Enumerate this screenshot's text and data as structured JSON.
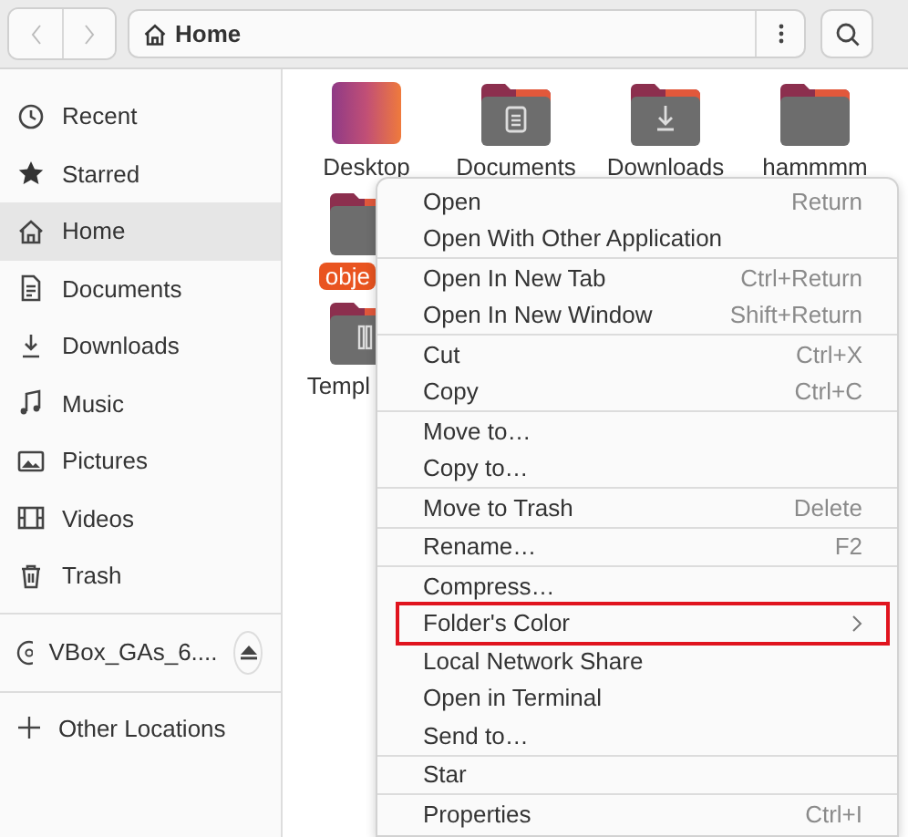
{
  "header": {
    "location": "Home"
  },
  "sidebar": {
    "items": [
      {
        "label": "Recent",
        "selected": false
      },
      {
        "label": "Starred",
        "selected": false
      },
      {
        "label": "Home",
        "selected": true
      },
      {
        "label": "Documents",
        "selected": false
      },
      {
        "label": "Downloads",
        "selected": false
      },
      {
        "label": "Music",
        "selected": false
      },
      {
        "label": "Pictures",
        "selected": false
      },
      {
        "label": "Videos",
        "selected": false
      },
      {
        "label": "Trash",
        "selected": false
      }
    ],
    "devices": [
      {
        "label": "VBox_GAs_6...."
      }
    ],
    "other": [
      {
        "label": "Other Locations"
      }
    ]
  },
  "files": [
    {
      "name": "Desktop",
      "kind": "gradient",
      "selected": false
    },
    {
      "name": "Documents",
      "kind": "folder",
      "selected": false
    },
    {
      "name": "Downloads",
      "kind": "folder",
      "selected": false
    },
    {
      "name": "hammmm",
      "kind": "folder",
      "selected": false
    },
    {
      "name": "obje",
      "kind": "folder",
      "selected": true
    },
    {
      "name": "Templ",
      "kind": "folder",
      "selected": false
    }
  ],
  "context_menu": {
    "sections": [
      [
        {
          "label": "Open",
          "shortcut": "Return",
          "highlighted": false
        },
        {
          "label": "Open With Other Application",
          "highlighted": false
        }
      ],
      [
        {
          "label": "Open In New Tab",
          "shortcut": "Ctrl+Return",
          "highlighted": false
        },
        {
          "label": "Open In New Window",
          "shortcut": "Shift+Return",
          "highlighted": false
        }
      ],
      [
        {
          "label": "Cut",
          "shortcut": "Ctrl+X",
          "highlighted": false
        },
        {
          "label": "Copy",
          "shortcut": "Ctrl+C",
          "highlighted": false
        }
      ],
      [
        {
          "label": "Move to…",
          "highlighted": false
        },
        {
          "label": "Copy to…",
          "highlighted": false
        }
      ],
      [
        {
          "label": "Move to Trash",
          "shortcut": "Delete",
          "highlighted": false
        }
      ],
      [
        {
          "label": "Rename…",
          "shortcut": "F2",
          "highlighted": false
        }
      ],
      [
        {
          "label": "Compress…",
          "highlighted": false
        },
        {
          "label": "Folder's Color",
          "kind": "submenu",
          "highlighted": true
        },
        {
          "label": "Local Network Share",
          "highlighted": false
        },
        {
          "label": "Open in Terminal",
          "highlighted": false
        },
        {
          "label": "Send to…",
          "highlighted": false
        }
      ],
      [
        {
          "label": "Star",
          "highlighted": false
        }
      ],
      [
        {
          "label": "Properties",
          "shortcut": "Ctrl+I",
          "highlighted": false
        }
      ]
    ]
  }
}
